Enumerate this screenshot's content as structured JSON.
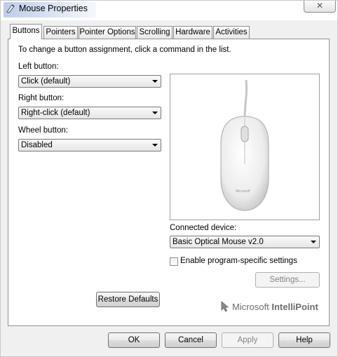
{
  "window": {
    "title": "Mouse Properties",
    "close_glyph": "✕"
  },
  "tabs": [
    {
      "label": "Buttons",
      "active": true
    },
    {
      "label": "Pointers"
    },
    {
      "label": "Pointer Options"
    },
    {
      "label": "Scrolling"
    },
    {
      "label": "Hardware"
    },
    {
      "label": "Activities"
    }
  ],
  "panel": {
    "instruction": "To change a button assignment, click a command in the list.",
    "left_button": {
      "label": "Left button:",
      "value": "Click (default)"
    },
    "right_button": {
      "label": "Right button:",
      "value": "Right-click (default)"
    },
    "wheel_button": {
      "label": "Wheel button:",
      "value": "Disabled"
    },
    "connected_device": {
      "label": "Connected device:",
      "value": "Basic Optical Mouse v2.0"
    },
    "program_specific": {
      "label": "Enable program-specific settings",
      "checked": false
    },
    "settings_button": "Settings...",
    "restore_button": "Restore Defaults",
    "mouse_logo_text": "Microsoft",
    "brand": {
      "prefix": "Microsoft ",
      "product": "IntelliPoint",
      "icon": "mouse-cursor-icon"
    }
  },
  "footer": {
    "ok": "OK",
    "cancel": "Cancel",
    "apply": "Apply",
    "help": "Help"
  },
  "colors": {
    "title_glow": "#466ebe",
    "panel_border": "#8e8f8f",
    "brand_gray": "#6d6d6d"
  }
}
